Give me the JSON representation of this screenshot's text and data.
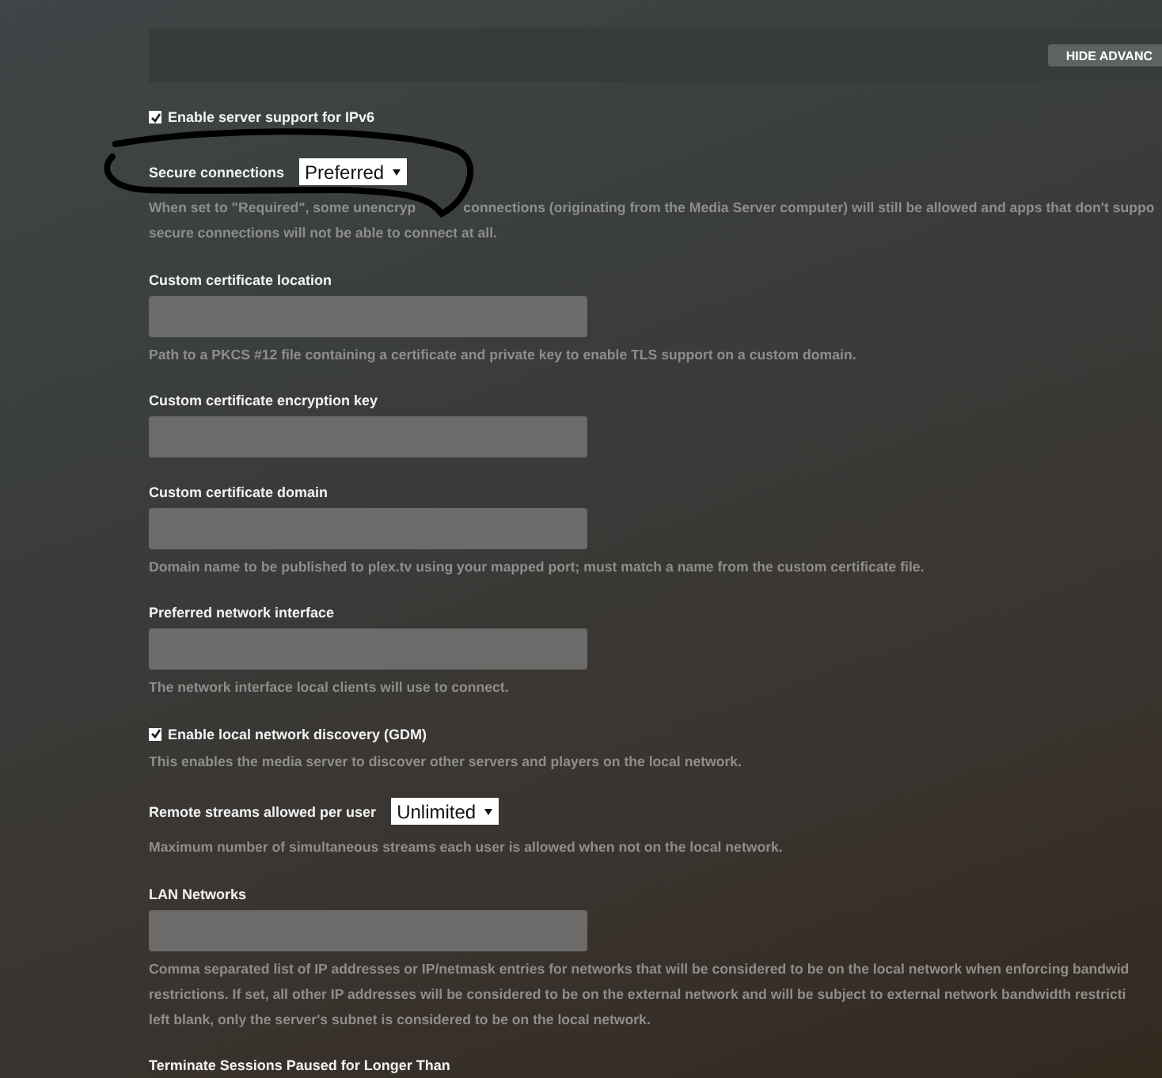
{
  "header": {
    "button": "HIDE ADVANC"
  },
  "settings": [
    {
      "kind": "checkbox",
      "label": "Enable server support for IPv6",
      "checked": true
    },
    {
      "kind": "select",
      "label": "Secure connections",
      "value": "Preferred",
      "description": [
        [
          "When set to \"Required\", some unencryp",
          "connections (originating from the Media Server computer) will still be allowed and apps that don't suppo"
        ],
        [
          "secure connections will not be able to connect at all."
        ]
      ]
    },
    {
      "kind": "text",
      "label": "Custom certificate location",
      "description": [
        [
          "Path to a PKCS #12 file containing a certificate and private key to enable TLS support on a custom domain."
        ]
      ]
    },
    {
      "kind": "text",
      "label": "Custom certificate encryption key"
    },
    {
      "kind": "text",
      "label": "Custom certificate domain",
      "description": [
        [
          "Domain name to be published to plex.tv using your mapped port; must match a name from the custom certificate file."
        ]
      ]
    },
    {
      "kind": "text",
      "label": "Preferred network interface",
      "description": [
        [
          "The network interface local clients will use to connect."
        ]
      ]
    },
    {
      "kind": "checkbox",
      "label": "Enable local network discovery (GDM)",
      "checked": true,
      "description": [
        [
          "This enables the media server to discover other servers and players on the local network."
        ]
      ]
    },
    {
      "kind": "select",
      "label": "Remote streams allowed per user",
      "value": "Unlimited",
      "description": [
        [
          "Maximum number of simultaneous streams each user is allowed when not on the local network."
        ]
      ]
    },
    {
      "kind": "text",
      "label": "LAN Networks",
      "description": [
        [
          "Comma separated list of IP addresses or IP/netmask entries for networks that will be considered to be on the local network when enforcing bandwid"
        ],
        [
          "restrictions. If set, all other IP addresses will be considered to be on the external network and will be subject to external network bandwidth restricti"
        ],
        [
          "left blank, only the server's subnet is considered to be on the local network."
        ]
      ]
    },
    {
      "kind": "label",
      "label": "Terminate Sessions Paused for Longer Than"
    }
  ]
}
